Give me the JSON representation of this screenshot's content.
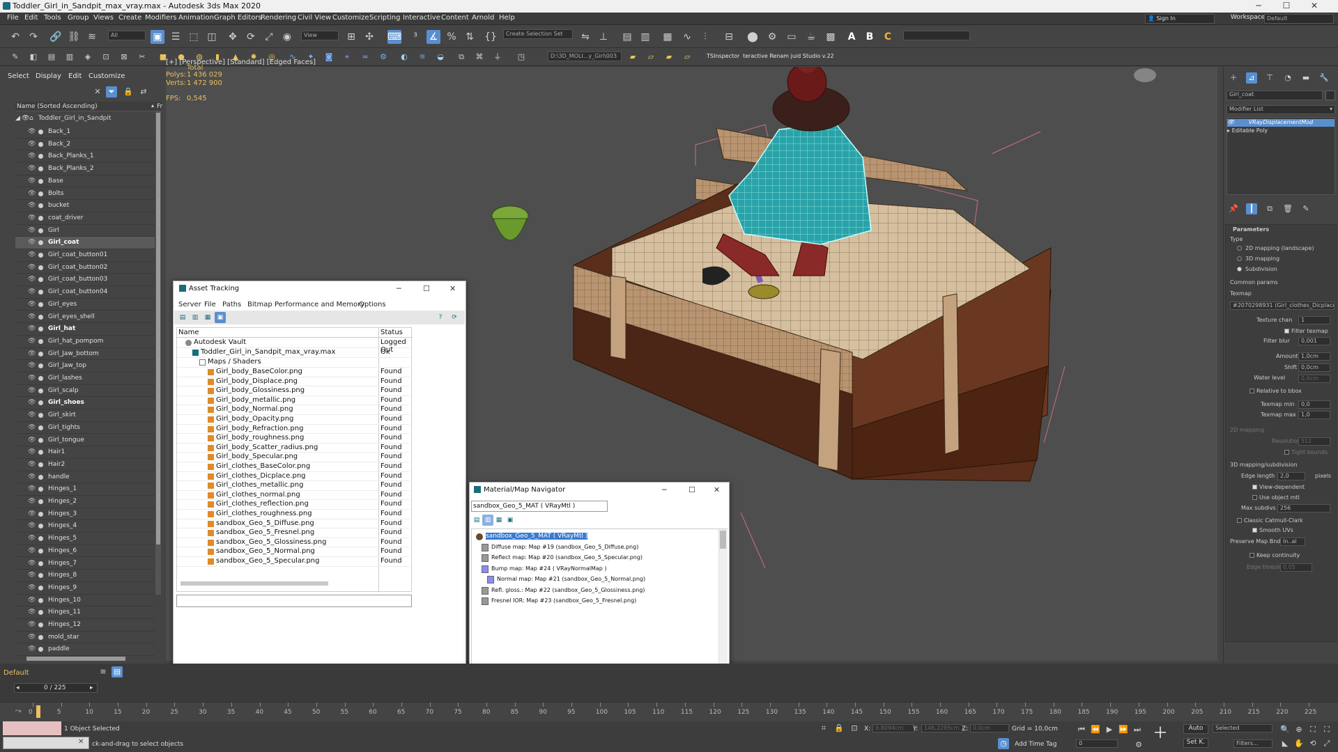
{
  "window": {
    "title": "Toddler_Girl_in_Sandpit_max_vray.max - Autodesk 3ds Max 2020"
  },
  "menu": [
    "File",
    "Edit",
    "Tools",
    "Group",
    "Views",
    "Create",
    "Modifiers",
    "Animation",
    "Graph Editors",
    "Rendering",
    "Civil View",
    "Customize",
    "Scripting",
    "Interactive",
    "Content",
    "Arnold",
    "Help"
  ],
  "account": {
    "signin": "Sign In",
    "workspaces_label": "Workspaces:",
    "workspace": "Default"
  },
  "toolbar": {
    "filter": "All",
    "refcoord": "View",
    "selection_set": "Create Selection Set",
    "path": "D:\\3D_MOLI...y_Girl\\003",
    "ts": "TSInspector",
    "renam": "teractive Renam juid Studio v.22"
  },
  "scene_explorer": {
    "tabs": [
      "Select",
      "Display",
      "Edit",
      "Customize"
    ],
    "header": "Name (Sorted Ascending)",
    "hdr2": "Fr",
    "root": "Toddler_Girl_in_Sandpit",
    "items": [
      "Back_1",
      "Back_2",
      "Back_Planks_1",
      "Back_Planks_2",
      "Base",
      "Bolts",
      "bucket",
      "coat_driver",
      "Girl",
      "Girl_coat",
      "Girl_coat_button01",
      "Girl_coat_button02",
      "Girl_coat_button03",
      "Girl_coat_button04",
      "Girl_eyes",
      "Girl_eyes_shell",
      "Girl_hat",
      "Girl_hat_pompom",
      "Girl_Jaw_bottom",
      "Girl_Jaw_top",
      "Girl_lashes",
      "Girl_scalp",
      "Girl_shoes",
      "Girl_skirt",
      "Girl_tights",
      "Girl_tongue",
      "Hair1",
      "Hair2",
      "handle",
      "Hinges_1",
      "Hinges_2",
      "Hinges_3",
      "Hinges_4",
      "Hinges_5",
      "Hinges_6",
      "Hinges_7",
      "Hinges_8",
      "Hinges_9",
      "Hinges_10",
      "Hinges_11",
      "Hinges_12",
      "mold_star",
      "paddle"
    ],
    "layer": "Default"
  },
  "viewport": {
    "label": "[+] [Perspective] [Standard] [Edged Faces]",
    "total": "Total",
    "polys_label": "Polys:",
    "polys": "1 436 029",
    "verts_label": "Verts:",
    "verts": "1 472 900",
    "fps_label": "FPS:",
    "fps": "0,545"
  },
  "asset_tracking": {
    "title": "Asset Tracking",
    "menu": [
      "Server",
      "File",
      "Paths",
      "Bitmap Performance and Memory",
      "Options"
    ],
    "col_name": "Name",
    "col_status": "Status",
    "vault": {
      "name": "Autodesk Vault",
      "status": "Logged Out"
    },
    "file": {
      "name": "Toddler_Girl_in_Sandpit_max_vray.max",
      "status": "Ok"
    },
    "group": "Maps / Shaders",
    "maps": [
      "Girl_body_BaseColor.png",
      "Girl_body_Displace.png",
      "Girl_body_Glossiness.png",
      "Girl_body_metallic.png",
      "Girl_body_Normal.png",
      "Girl_body_Opacity.png",
      "Girl_body_Refraction.png",
      "Girl_body_roughness.png",
      "Girl_body_Scatter_radius.png",
      "Girl_body_Specular.png",
      "Girl_clothes_BaseColor.png",
      "Girl_clothes_Dicplace.png",
      "Girl_clothes_metallic.png",
      "Girl_clothes_normal.png",
      "Girl_clothes_reflection.png",
      "Girl_clothes_roughness.png",
      "sandbox_Geo_5_Diffuse.png",
      "sandbox_Geo_5_Fresnel.png",
      "sandbox_Geo_5_Glossiness.png",
      "sandbox_Geo_5_Normal.png",
      "sandbox_Geo_5_Specular.png"
    ],
    "found": "Found"
  },
  "mat_nav": {
    "title": "Material/Map Navigator",
    "field": "sandbox_Geo_5_MAT  ( VRayMtl )",
    "root": "sandbox_Geo_5_MAT  ( VRayMtl )",
    "items": [
      "Diffuse map: Map #19 (sandbox_Geo_5_Diffuse.png)",
      "Reflect map: Map #20 (sandbox_Geo_5_Specular.png)",
      "Bump map: Map #24  ( VRayNormalMap )",
      "Normal map: Map #21 (sandbox_Geo_5_Normal.png)",
      "Refl. gloss.: Map #22 (sandbox_Geo_5_Glossiness.png)",
      "Fresnel IOR: Map #23 (sandbox_Geo_5_Fresnel.png)"
    ]
  },
  "command_panel": {
    "object_name": "Girl_coat",
    "modifier_list": "Modifier List",
    "stack": [
      "VRayDisplacementMod",
      "Editable Poly"
    ],
    "parameters": "Parameters",
    "type_label": "Type",
    "types": [
      "2D mapping (landscape)",
      "3D mapping",
      "Subdivision"
    ],
    "common": "Common params",
    "texmap_label": "Texmap",
    "texmap": "#2070298931 (Girl_clothes_Dicplace",
    "texture_chan_label": "Texture chan",
    "texture_chan": "1",
    "filter_texmap": "Filter texmap",
    "filter_blur_label": "Filter blur",
    "filter_blur": "0,001",
    "amount_label": "Amount",
    "amount": "1,0cm",
    "shift_label": "Shift",
    "shift": "0,0cm",
    "water_label": "Water level",
    "water": "0,0cm",
    "relative": "Relative to bbox",
    "texmin_label": "Texmap min",
    "texmin": "0,0",
    "texmax_label": "Texmap max",
    "texmax": "1,0",
    "map2d": "2D mapping",
    "resolution_label": "Resolution",
    "resolution": "512",
    "tight": "Tight bounds",
    "map3d": "3D mapping/subdivision",
    "edge_label": "Edge length",
    "edge": "2,0",
    "pixels": "pixels",
    "view_dep": "View-dependent",
    "use_mtl": "Use object mtl",
    "maxsub_label": "Max subdivs",
    "maxsub": "256",
    "catmull": "Classic Catmull-Clark",
    "smooth": "Smooth UVs",
    "preserve_label": "Preserve Map Bnd",
    "preserve": "In..al",
    "keep": "Keep continuity",
    "edge_thresh_label": "Edge thresh",
    "edge_thresh": "0,05"
  },
  "timeline": {
    "frame": "0 / 225",
    "ticks": [
      "0",
      "5",
      "10",
      "15",
      "20",
      "25",
      "30",
      "35",
      "40",
      "45",
      "50",
      "55",
      "60",
      "65",
      "70",
      "75",
      "80",
      "85",
      "90",
      "95",
      "100",
      "105",
      "110",
      "115",
      "120",
      "125",
      "130",
      "135",
      "140",
      "145",
      "150",
      "155",
      "160",
      "165",
      "170",
      "175",
      "180",
      "185",
      "190",
      "195",
      "200",
      "205",
      "210",
      "215",
      "220",
      "225"
    ]
  },
  "status": {
    "selected": "1 Object Selected",
    "hint": "ck-and-drag to select objects",
    "x_label": "X:",
    "x": "9,8094cm",
    "y_label": "Y:",
    "y": "146,2295cm",
    "z_label": "Z:",
    "z": "0,0cm",
    "grid": "Grid = 10,0cm",
    "add_time_tag": "Add Time Tag",
    "auto": "Auto",
    "setk": "Set K.",
    "key_mode": "Selected",
    "filters": "Filters...",
    "frame_field": "0"
  }
}
